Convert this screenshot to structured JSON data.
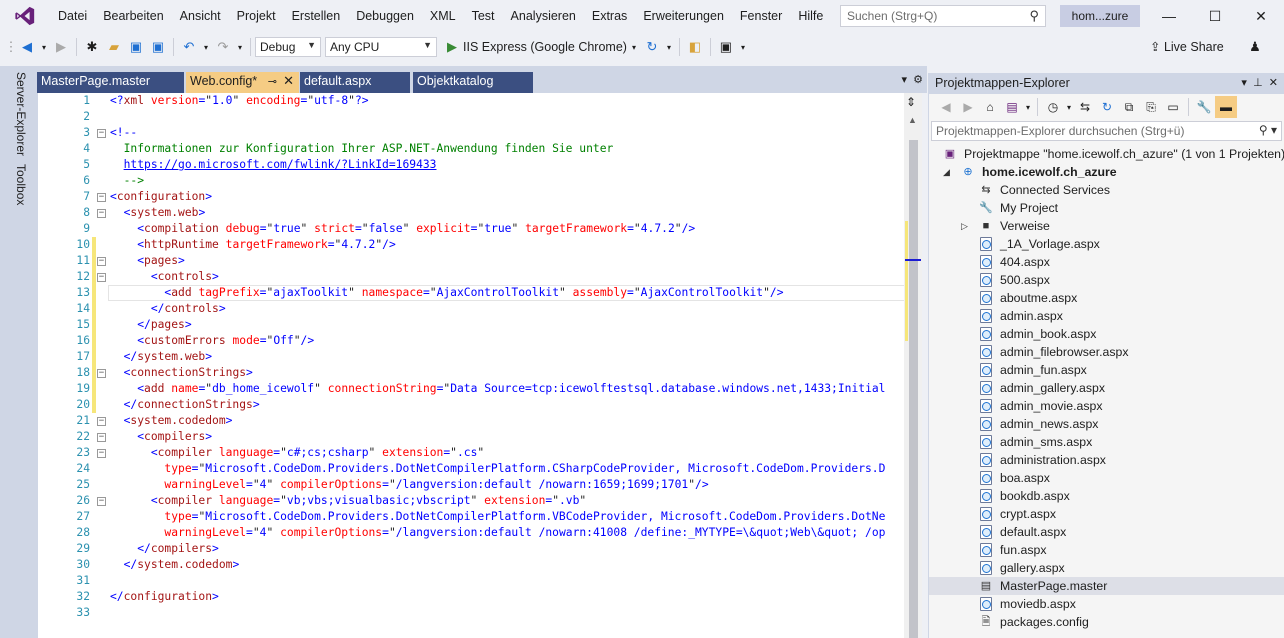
{
  "menubar": {
    "items": [
      "Datei",
      "Bearbeiten",
      "Ansicht",
      "Projekt",
      "Erstellen",
      "Debuggen",
      "XML",
      "Test",
      "Analysieren",
      "Extras",
      "Erweiterungen",
      "Fenster",
      "Hilfe"
    ],
    "search_placeholder": "Suchen (Strg+Q)",
    "solution_badge": "hom...zure"
  },
  "toolbar": {
    "configuration": "Debug",
    "platform": "Any CPU",
    "run_target": "IIS Express (Google Chrome)",
    "live_share": "Live Share"
  },
  "side_tabs": [
    "Server-Explorer",
    "Toolbox"
  ],
  "doc_tabs": [
    {
      "label": "MasterPage.master",
      "active": false
    },
    {
      "label": "Web.config*",
      "active": true
    },
    {
      "label": "default.aspx",
      "active": false
    },
    {
      "label": "Objektkatalog",
      "active": false
    }
  ],
  "editor": {
    "lines": [
      {
        "n": "1",
        "fold": "",
        "chg": "",
        "html": "<span class='punc'>&lt;?</span><span class='tag'>xml</span> <span class='attr'>version</span><span class='punc'>=</span>\"<span class='val'>1.0</span>\" <span class='attr'>encoding</span><span class='punc'>=</span>\"<span class='val'>utf-8</span>\"<span class='punc'>?&gt;</span>"
      },
      {
        "n": "2",
        "fold": "",
        "chg": "",
        "html": ""
      },
      {
        "n": "3",
        "fold": "−",
        "chg": "",
        "html": "<span class='punc'>&lt;!--</span>"
      },
      {
        "n": "4",
        "fold": "",
        "chg": "",
        "html": "<span class='cmt'>  Informationen zur Konfiguration Ihrer ASP.NET-Anwendung finden Sie unter</span>"
      },
      {
        "n": "5",
        "fold": "",
        "chg": "",
        "html": "  <span class='lnk'>https://go.microsoft.com/fwlink/?LinkId=169433</span>"
      },
      {
        "n": "6",
        "fold": "",
        "chg": "",
        "html": "<span class='cmt'>  --&gt;</span>"
      },
      {
        "n": "7",
        "fold": "−",
        "chg": "",
        "html": "<span class='punc'>&lt;</span><span class='tag'>configuration</span><span class='punc'>&gt;</span>"
      },
      {
        "n": "8",
        "fold": "−",
        "chg": "",
        "html": "  <span class='punc'>&lt;</span><span class='tag'>system.web</span><span class='punc'>&gt;</span>"
      },
      {
        "n": "9",
        "fold": "",
        "chg": "",
        "html": "    <span class='punc'>&lt;</span><span class='tag'>compilation</span> <span class='attr'>debug</span><span class='punc'>=</span>\"<span class='val'>true</span>\" <span class='attr'>strict</span><span class='punc'>=</span>\"<span class='val'>false</span>\" <span class='attr'>explicit</span><span class='punc'>=</span>\"<span class='val'>true</span>\" <span class='attr'>targetFramework</span><span class='punc'>=</span>\"<span class='val'>4.7.2</span>\"<span class='punc'>/&gt;</span>"
      },
      {
        "n": "10",
        "fold": "",
        "chg": "yellow",
        "html": "    <span class='punc'>&lt;</span><span class='tag'>httpRuntime</span> <span class='attr'>targetFramework</span><span class='punc'>=</span>\"<span class='val'>4.7.2</span>\"<span class='punc'>/&gt;</span>"
      },
      {
        "n": "11",
        "fold": "−",
        "chg": "yellow",
        "html": "    <span class='punc'>&lt;</span><span class='tag'>pages</span><span class='punc'>&gt;</span>"
      },
      {
        "n": "12",
        "fold": "−",
        "chg": "yellow",
        "html": "      <span class='punc'>&lt;</span><span class='tag'>controls</span><span class='punc'>&gt;</span>"
      },
      {
        "n": "13",
        "fold": "",
        "chg": "yellow",
        "current": true,
        "html": "        <span class='punc'>&lt;</span><span class='tag'>add</span> <span class='attr'>tagPrefix</span><span class='punc'>=</span>\"<span class='val'>ajaxToolkit</span>\" <span class='attr'>namespace</span><span class='punc'>=</span>\"<span class='val'>AjaxControlToolkit</span>\" <span class='attr'>assembly</span><span class='punc'>=</span>\"<span class='val'>AjaxControlToolkit</span>\"<span class='punc'>/&gt;</span>"
      },
      {
        "n": "14",
        "fold": "",
        "chg": "yellow",
        "html": "      <span class='punc'>&lt;/</span><span class='tag'>controls</span><span class='punc'>&gt;</span>"
      },
      {
        "n": "15",
        "fold": "",
        "chg": "yellow",
        "html": "    <span class='punc'>&lt;/</span><span class='tag'>pages</span><span class='punc'>&gt;</span>"
      },
      {
        "n": "16",
        "fold": "",
        "chg": "yellow",
        "html": "    <span class='punc'>&lt;</span><span class='tag'>customErrors</span> <span class='attr'>mode</span><span class='punc'>=</span>\"<span class='val'>Off</span>\"<span class='punc'>/&gt;</span>"
      },
      {
        "n": "17",
        "fold": "",
        "chg": "yellow",
        "html": "  <span class='punc'>&lt;/</span><span class='tag'>system.web</span><span class='punc'>&gt;</span>"
      },
      {
        "n": "18",
        "fold": "−",
        "chg": "yellow",
        "html": "  <span class='punc'>&lt;</span><span class='tag'>connectionStrings</span><span class='punc'>&gt;</span>"
      },
      {
        "n": "19",
        "fold": "",
        "chg": "yellow",
        "html": "    <span class='punc'>&lt;</span><span class='tag'>add</span> <span class='attr'>name</span><span class='punc'>=</span>\"<span class='val'>db_home_icewolf</span>\" <span class='attr'>connectionString</span><span class='punc'>=</span>\"<span class='val'>Data Source=tcp:icewolftestsql.database.windows.net,1433;Initial</span>"
      },
      {
        "n": "20",
        "fold": "",
        "chg": "yellow",
        "html": "  <span class='punc'>&lt;/</span><span class='tag'>connectionStrings</span><span class='punc'>&gt;</span>"
      },
      {
        "n": "21",
        "fold": "−",
        "chg": "",
        "html": "  <span class='punc'>&lt;</span><span class='tag'>system.codedom</span><span class='punc'>&gt;</span>"
      },
      {
        "n": "22",
        "fold": "−",
        "chg": "",
        "html": "    <span class='punc'>&lt;</span><span class='tag'>compilers</span><span class='punc'>&gt;</span>"
      },
      {
        "n": "23",
        "fold": "−",
        "chg": "",
        "html": "      <span class='punc'>&lt;</span><span class='tag'>compiler</span> <span class='attr'>language</span><span class='punc'>=</span>\"<span class='val'>c#;cs;csharp</span>\" <span class='attr'>extension</span><span class='punc'>=</span>\"<span class='val'>.cs</span>\""
      },
      {
        "n": "24",
        "fold": "",
        "chg": "",
        "html": "        <span class='attr'>type</span><span class='punc'>=</span>\"<span class='val'>Microsoft.CodeDom.Providers.DotNetCompilerPlatform.CSharpCodeProvider, Microsoft.CodeDom.Providers.D</span>"
      },
      {
        "n": "25",
        "fold": "",
        "chg": "",
        "html": "        <span class='attr'>warningLevel</span><span class='punc'>=</span>\"<span class='val'>4</span>\" <span class='attr'>compilerOptions</span><span class='punc'>=</span>\"<span class='val'>/langversion:default /nowarn:1659;1699;1701</span>\"<span class='punc'>/&gt;</span>"
      },
      {
        "n": "26",
        "fold": "−",
        "chg": "",
        "html": "      <span class='punc'>&lt;</span><span class='tag'>compiler</span> <span class='attr'>language</span><span class='punc'>=</span>\"<span class='val'>vb;vbs;visualbasic;vbscript</span>\" <span class='attr'>extension</span><span class='punc'>=</span>\"<span class='val'>.vb</span>\""
      },
      {
        "n": "27",
        "fold": "",
        "chg": "",
        "html": "        <span class='attr'>type</span><span class='punc'>=</span>\"<span class='val'>Microsoft.CodeDom.Providers.DotNetCompilerPlatform.VBCodeProvider, Microsoft.CodeDom.Providers.DotNe</span>"
      },
      {
        "n": "28",
        "fold": "",
        "chg": "",
        "html": "        <span class='attr'>warningLevel</span><span class='punc'>=</span>\"<span class='val'>4</span>\" <span class='attr'>compilerOptions</span><span class='punc'>=</span>\"<span class='val'>/langversion:default /nowarn:41008 /define:_MYTYPE=\\&amp;quot;Web\\&amp;quot; /op</span>"
      },
      {
        "n": "29",
        "fold": "",
        "chg": "",
        "html": "    <span class='punc'>&lt;/</span><span class='tag'>compilers</span><span class='punc'>&gt;</span>"
      },
      {
        "n": "30",
        "fold": "",
        "chg": "",
        "html": "  <span class='punc'>&lt;/</span><span class='tag'>system.codedom</span><span class='punc'>&gt;</span>"
      },
      {
        "n": "31",
        "fold": "",
        "chg": "",
        "html": ""
      },
      {
        "n": "32",
        "fold": "",
        "chg": "",
        "html": "<span class='punc'>&lt;/</span><span class='tag'>configuration</span><span class='punc'>&gt;</span>"
      },
      {
        "n": "33",
        "fold": "",
        "chg": "",
        "html": ""
      }
    ]
  },
  "solution_explorer": {
    "title": "Projektmappen-Explorer",
    "search_placeholder": "Projektmappen-Explorer durchsuchen (Strg+ü)",
    "solution": "Projektmappe \"home.icewolf.ch_azure\" (1 von 1 Projekten)",
    "project": "home.icewolf.ch_azure",
    "items": [
      {
        "label": "Connected Services",
        "icon": "connected-services-icon",
        "glyph": "⇆"
      },
      {
        "label": "My Project",
        "icon": "wrench-icon",
        "glyph": "🔧"
      },
      {
        "label": "Verweise",
        "icon": "references-icon",
        "glyph": "■",
        "expander": true
      },
      {
        "label": "_1A_Vorlage.aspx",
        "icon": "aspx-file-icon"
      },
      {
        "label": "404.aspx",
        "icon": "aspx-file-icon"
      },
      {
        "label": "500.aspx",
        "icon": "aspx-file-icon"
      },
      {
        "label": "aboutme.aspx",
        "icon": "aspx-file-icon"
      },
      {
        "label": "admin.aspx",
        "icon": "aspx-file-icon"
      },
      {
        "label": "admin_book.aspx",
        "icon": "aspx-file-icon"
      },
      {
        "label": "admin_filebrowser.aspx",
        "icon": "aspx-file-icon"
      },
      {
        "label": "admin_fun.aspx",
        "icon": "aspx-file-icon"
      },
      {
        "label": "admin_gallery.aspx",
        "icon": "aspx-file-icon"
      },
      {
        "label": "admin_movie.aspx",
        "icon": "aspx-file-icon"
      },
      {
        "label": "admin_news.aspx",
        "icon": "aspx-file-icon"
      },
      {
        "label": "admin_sms.aspx",
        "icon": "aspx-file-icon"
      },
      {
        "label": "administration.aspx",
        "icon": "aspx-file-icon"
      },
      {
        "label": "boa.aspx",
        "icon": "aspx-file-icon"
      },
      {
        "label": "bookdb.aspx",
        "icon": "aspx-file-icon"
      },
      {
        "label": "crypt.aspx",
        "icon": "aspx-file-icon"
      },
      {
        "label": "default.aspx",
        "icon": "aspx-file-icon"
      },
      {
        "label": "fun.aspx",
        "icon": "aspx-file-icon"
      },
      {
        "label": "gallery.aspx",
        "icon": "aspx-file-icon"
      },
      {
        "label": "MasterPage.master",
        "icon": "master-page-icon",
        "glyph": "▤",
        "selected": true
      },
      {
        "label": "moviedb.aspx",
        "icon": "aspx-file-icon"
      },
      {
        "label": "packages.config",
        "icon": "config-file-icon",
        "glyph": "🗎"
      }
    ]
  },
  "colors": {
    "accent": "#68217a",
    "tab_strip": "#cfd6e5",
    "inactive_tab": "#3b4f81",
    "active_tab": "#f5cc84",
    "run_green": "#388a34",
    "change_marker": "#f6e67a"
  }
}
